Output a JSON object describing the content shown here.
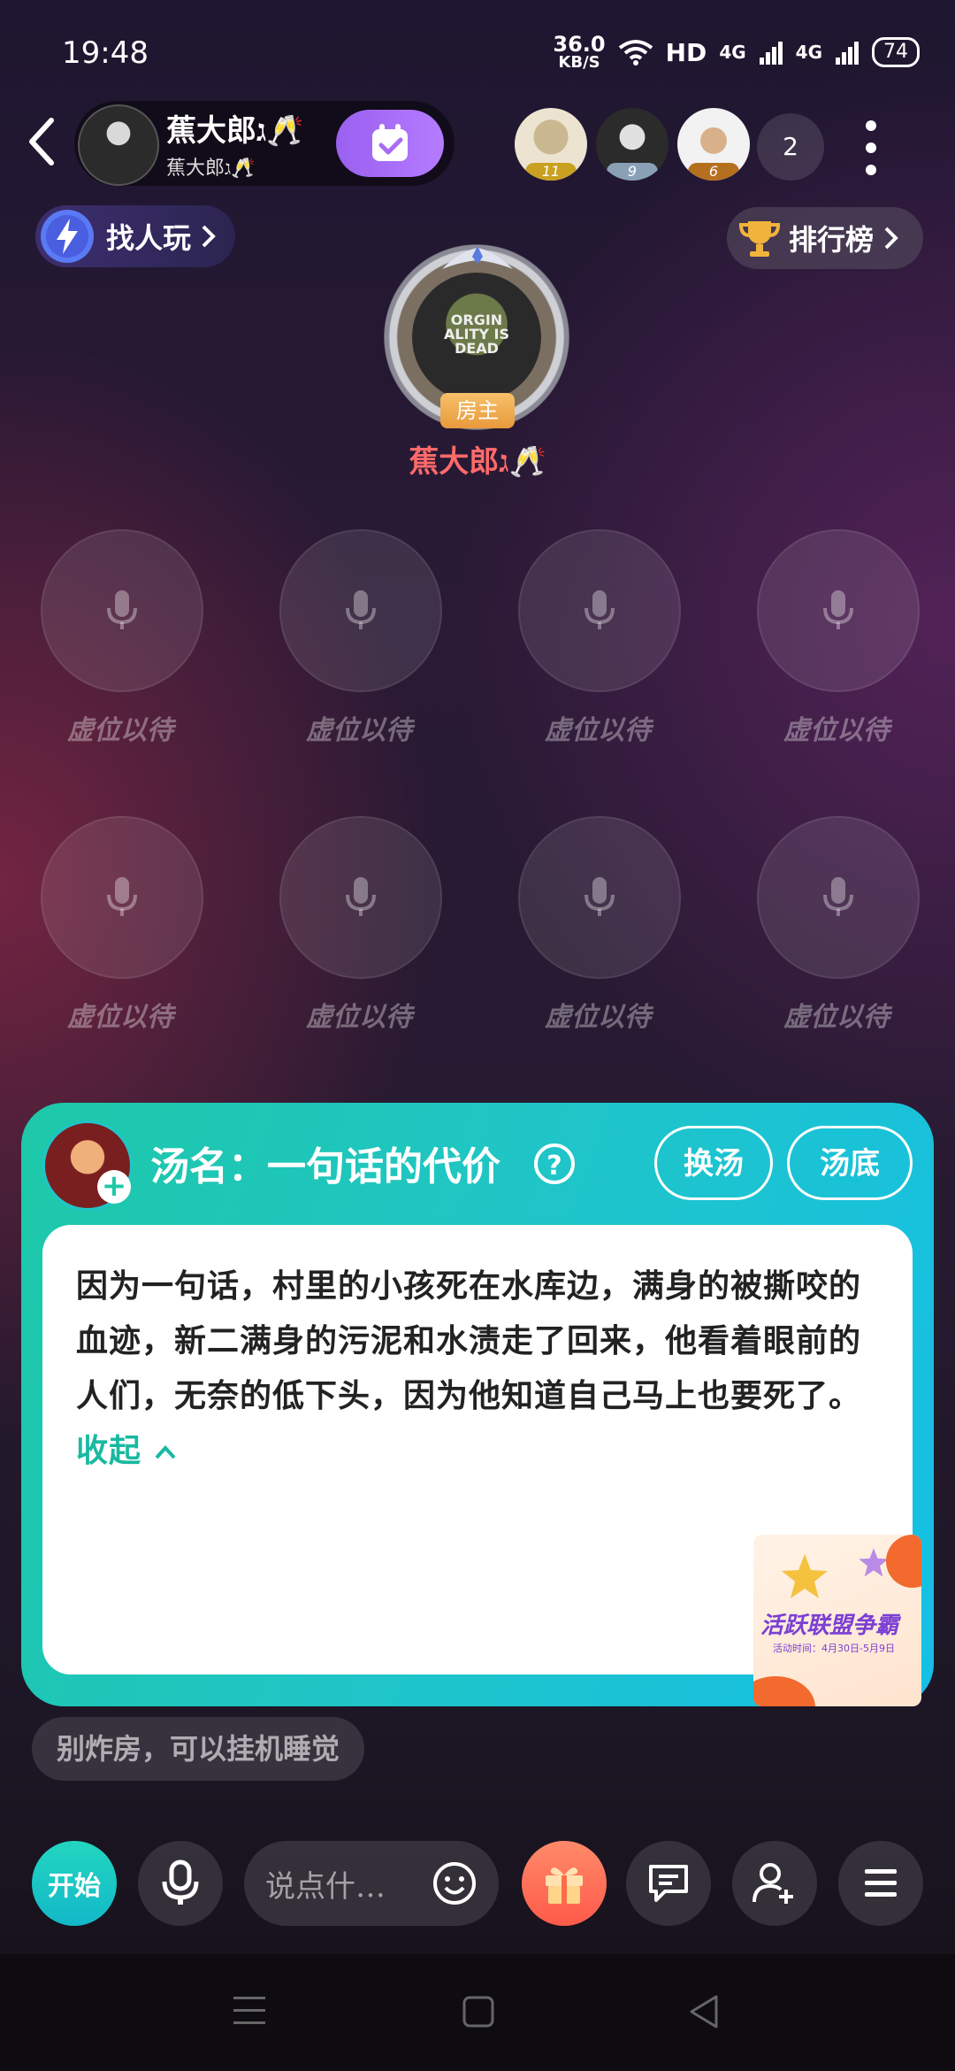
{
  "status_bar": {
    "time": "19:48",
    "net_speed_value": "36.0",
    "net_speed_unit": "KB/S",
    "hd_label": "HD",
    "sim1": "4G",
    "sim2": "4G",
    "battery": "74"
  },
  "header": {
    "room_name": "蕉大郎ג🥂",
    "room_sub": "蕉大郎ג🥂",
    "audience": [
      {
        "level": "11",
        "badge_color": "#c9a020"
      },
      {
        "level": "9",
        "badge_color": "#8aa0b5"
      },
      {
        "level": "6",
        "badge_color": "#b5701f"
      }
    ],
    "audience_count": "2"
  },
  "find_play": {
    "label": "找人玩",
    "icon": "lightning-icon"
  },
  "leaderboard": {
    "label": "排行榜",
    "icon": "trophy-icon"
  },
  "host": {
    "badge": "房主",
    "name": "蕉大郎ג🥂",
    "photo_text": "ORGIN ALITY IS DEAD"
  },
  "seats": [
    {
      "label": "虚位以待"
    },
    {
      "label": "虚位以待"
    },
    {
      "label": "虚位以待"
    },
    {
      "label": "虚位以待"
    },
    {
      "label": "虚位以待"
    },
    {
      "label": "虚位以待"
    },
    {
      "label": "虚位以待"
    },
    {
      "label": "虚位以待"
    }
  ],
  "soup_card": {
    "title": "汤名：一句话的代价",
    "switch_label": "换汤",
    "answer_label": "汤底",
    "text": "因为一句话，村里的小孩死在水库边，满身的被撕咬的血迹，新二满身的污泥和水渍走了回来，他看着眼前的人们，无奈的低下头，因为他知道自己马上也要死了。",
    "collapse_label": "收起",
    "event_title": "活跃联盟争霸",
    "event_sub": "活动时间：4月30日-5月9日"
  },
  "notice": "别炸房，可以挂机睡觉",
  "toolbar": {
    "start_label": "开始",
    "input_placeholder": "说点什…"
  },
  "colors": {
    "accent_teal": "#1fc5c8",
    "host_name": "#ff6a6a",
    "check_purple": "#a86cf5"
  }
}
